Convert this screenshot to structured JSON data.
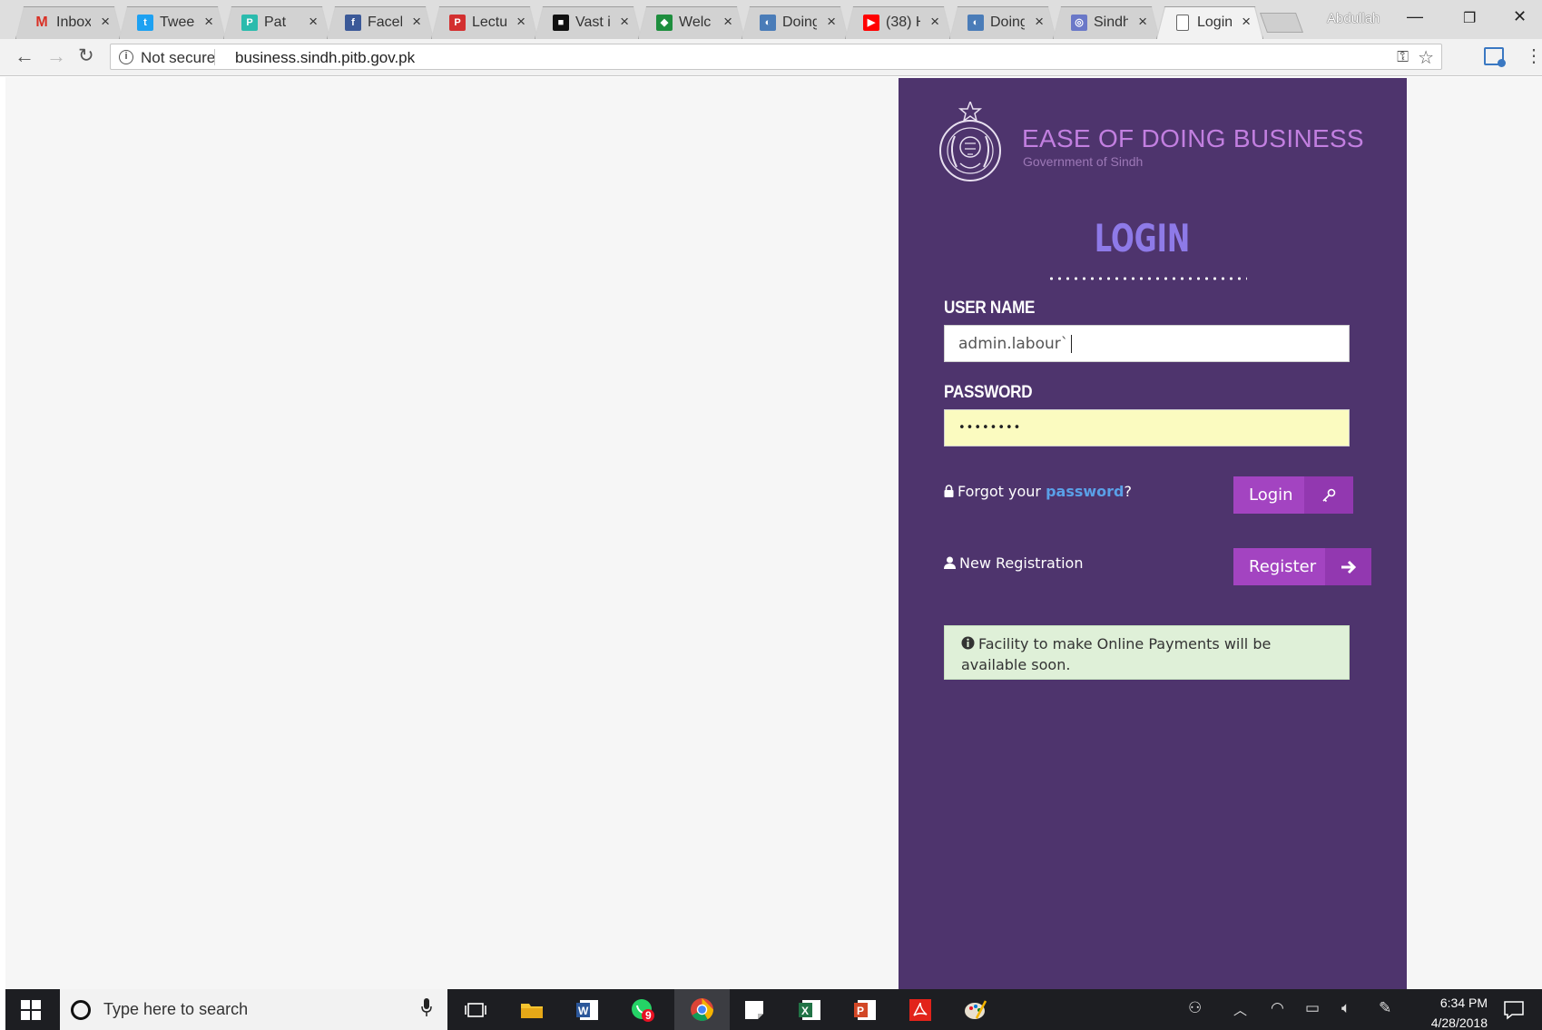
{
  "browser": {
    "tabs": [
      {
        "title": "Inbox",
        "favicon": "gmail-icon",
        "color": "#d93025",
        "glyph": "M"
      },
      {
        "title": "Tweet",
        "favicon": "twitter-icon",
        "color": "#1da1f2",
        "glyph": "t"
      },
      {
        "title": "Pat",
        "favicon": "p-icon",
        "color": "#2bbbad",
        "glyph": "P"
      },
      {
        "title": "Faceb",
        "favicon": "facebook-icon",
        "color": "#3b5998",
        "glyph": "f"
      },
      {
        "title": "Lectu",
        "favicon": "lecture-icon",
        "color": "#d32f2f",
        "glyph": "P"
      },
      {
        "title": "Vast i",
        "favicon": "vast-icon",
        "color": "#111111",
        "glyph": "■"
      },
      {
        "title": "Welc",
        "favicon": "welcome-icon",
        "color": "#1e8e3e",
        "glyph": "◆"
      },
      {
        "title": "Doing",
        "favicon": "globe-icon",
        "color": "#4a7cb8",
        "glyph": "◐"
      },
      {
        "title": "(38) H",
        "favicon": "youtube-icon",
        "color": "#ff0000",
        "glyph": "▶"
      },
      {
        "title": "Doing",
        "favicon": "globe-icon",
        "color": "#4a7cb8",
        "glyph": "◐"
      },
      {
        "title": "Sindh",
        "favicon": "sindh-icon",
        "color": "#6a78c8",
        "glyph": "◎"
      },
      {
        "title": "Login",
        "favicon": "page-icon",
        "color": "#ffffff",
        "glyph": "",
        "active": true
      }
    ],
    "profile_name": "Abdullah",
    "security_label": "Not secure",
    "url": "business.sindh.pitb.gov.pk"
  },
  "brand": {
    "title": "EASE OF DOING BUSINESS",
    "subtitle": "Government of Sindh"
  },
  "login": {
    "heading": "LOGIN",
    "username_label": "USER NAME",
    "username_value": "admin.labour`",
    "password_label": "PASSWORD",
    "password_value": "••••••••",
    "forgot_prefix": "Forgot your ",
    "forgot_link": "password",
    "forgot_suffix": "?",
    "login_button": "Login",
    "new_registration": "New Registration",
    "register_button": "Register",
    "notice": "Facility to make Online Payments will be available soon."
  },
  "taskbar": {
    "search_placeholder": "Type here to search",
    "whatsapp_badge": "9",
    "time": "6:34 PM",
    "date": "4/28/2018"
  },
  "colors": {
    "panel": "#4e346d",
    "button": "#a344c1",
    "link": "#5aa0e8",
    "notice_bg": "#dff0d8"
  }
}
